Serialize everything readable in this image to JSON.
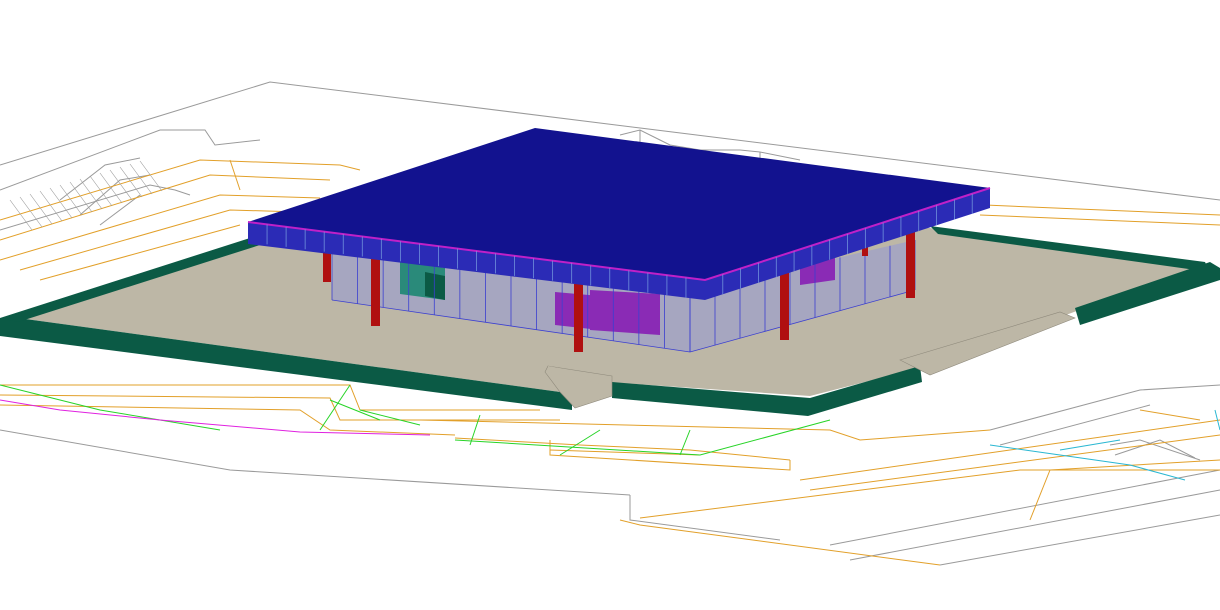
{
  "scene": {
    "background": "#ffffff",
    "colors": {
      "roof_top": "#12128f",
      "roof_fascia": "#2b2bb6",
      "roof_edge_highlight": "#c020c8",
      "columns": "#b01010",
      "plinth_wall": "#0b5a45",
      "plaza_floor": "#bdb7a6",
      "glass": "#9fa0c8",
      "mullions": "#3b3fd0",
      "interior_purple": "#8a2bb5",
      "interior_teal": "#2a8a7a",
      "site_lines_grey": "#9a9a9a",
      "site_lines_orange": "#e2a02a",
      "site_lines_green": "#27d427",
      "site_lines_magenta": "#e022e0",
      "site_lines_cyan": "#2ab7d2"
    }
  }
}
